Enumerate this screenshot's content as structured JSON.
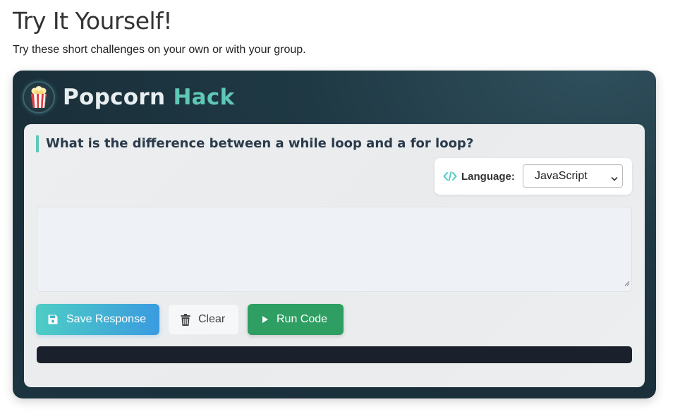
{
  "page": {
    "title": "Try It Yourself!",
    "subtitle": "Try these short challenges on your own or with your group."
  },
  "hack": {
    "title_main": "Popcorn",
    "title_accent": "Hack",
    "icon": "popcorn-icon",
    "question": "What is the difference between a while loop and a for loop?",
    "language": {
      "label": "Language:",
      "icon": "code-icon",
      "selected": "JavaScript"
    },
    "response": {
      "value": "",
      "placeholder": ""
    },
    "buttons": {
      "save_label": "Save Response",
      "save_icon": "floppy-disk-icon",
      "clear_label": "Clear",
      "clear_icon": "trash-icon",
      "run_label": "Run Code",
      "run_icon": "play-icon"
    },
    "output": ""
  },
  "colors": {
    "accent": "#5fc7b6",
    "card_bg": "#1f3944",
    "save_gradient_start": "#4ecdc4",
    "save_gradient_end": "#3a9be0",
    "run_bg": "#2e9e62",
    "output_bg": "#1b212c"
  }
}
